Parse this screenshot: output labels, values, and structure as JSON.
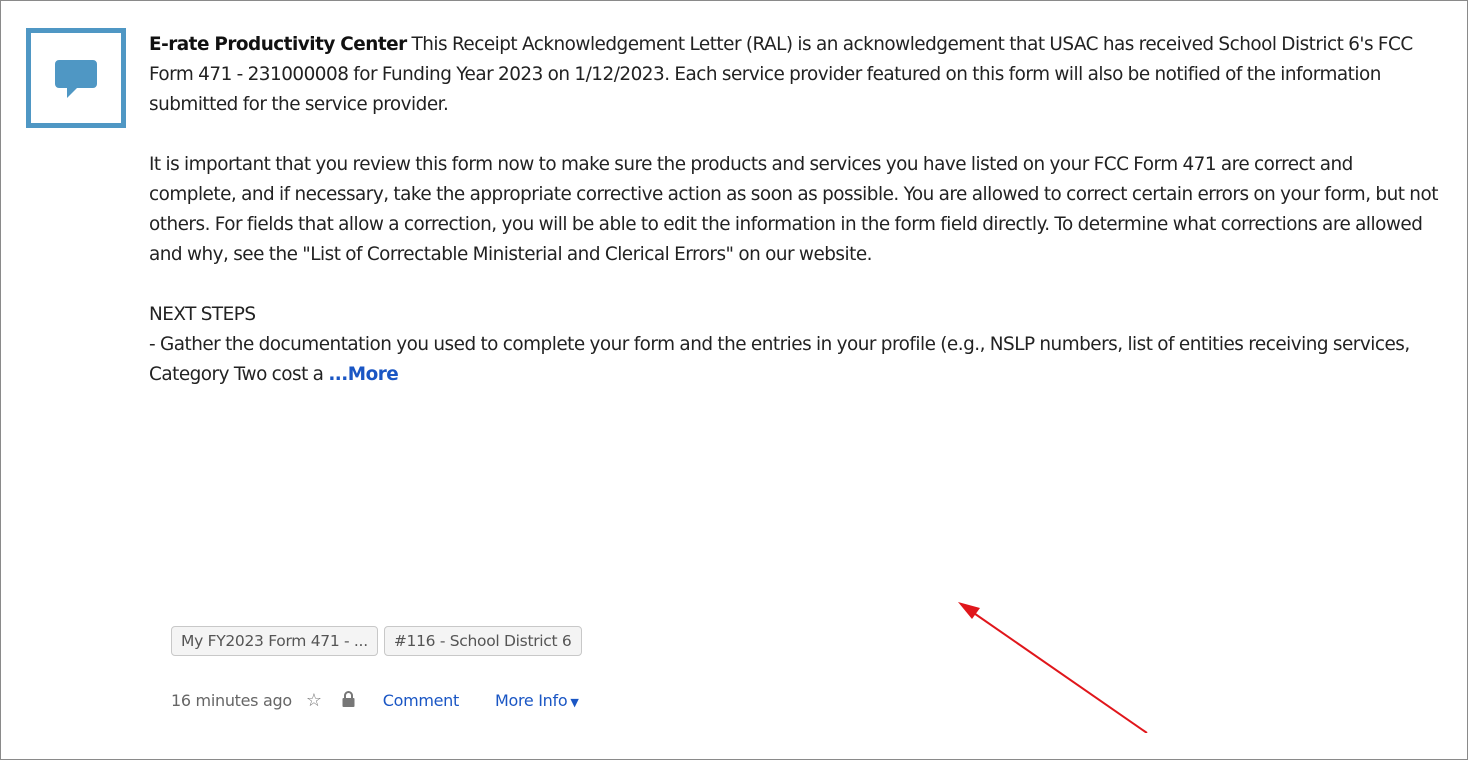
{
  "post": {
    "author": "E-rate Productivity Center",
    "paragraph1": "This Receipt Acknowledgement Letter (RAL) is an acknowledgement that USAC has received School District 6's FCC Form 471 - 231000008 for Funding Year 2023 on 1/12/2023.  Each service provider featured on this form will also be notified of the information submitted for the service provider.",
    "paragraph2": "It is important that you review this form now to make sure the products and services you have listed on your FCC Form 471 are correct and complete, and if necessary, take the appropriate corrective action as soon as possible.  You are allowed to correct certain errors on your form, but not others.  For fields that allow a correction, you will be able to edit the information in the form field directly.  To determine what corrections are allowed and why, see the \"List of Correctable Ministerial and Clerical Errors\" on our website.",
    "next_steps_heading": "NEXT STEPS",
    "next_steps_text": "- Gather the documentation you used to complete your form and the entries in your profile (e.g., NSLP numbers, list of entities receiving services, Category Two cost a",
    "more_label": "...More"
  },
  "tags": [
    {
      "label": "My FY2023 Form 471 - ..."
    },
    {
      "label": "#116 - School District 6"
    }
  ],
  "meta": {
    "time": "16 minutes ago",
    "comment_label": "Comment",
    "more_info_label": "More Info"
  },
  "colors": {
    "avatar_border": "#4f97c4",
    "link": "#1a56c4",
    "arrow": "#e0161b"
  },
  "icons": {
    "avatar": "chat-bubble-icon",
    "favorite": "star-outline-icon",
    "privacy": "lock-icon",
    "dropdown": "caret-down-icon"
  }
}
